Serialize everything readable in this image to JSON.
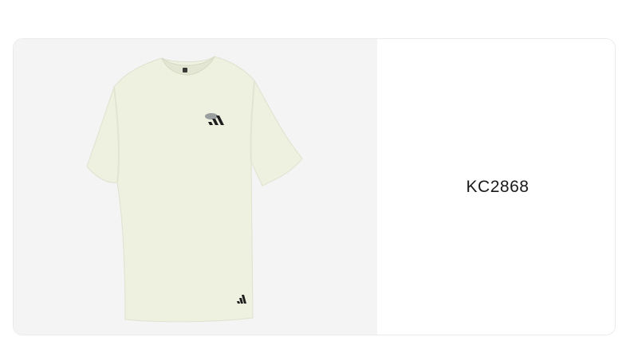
{
  "product": {
    "code": "KC2868",
    "image_icon": "tshirt-icon",
    "logo_icon": "adidas-logo-icon",
    "shirt_color": "#eef0e0",
    "panel_background": "#f4f4f4"
  }
}
